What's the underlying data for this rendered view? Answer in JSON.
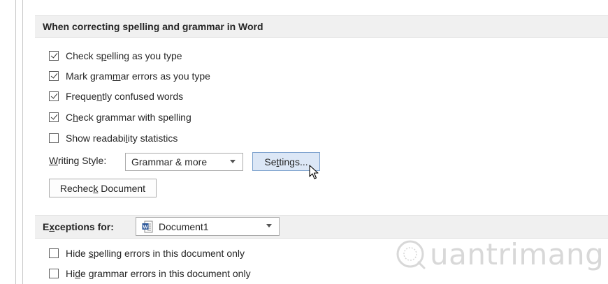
{
  "spelling_section": {
    "header": "When correcting spelling and grammar in Word",
    "options": [
      {
        "pre": "Check s",
        "acc": "p",
        "post": "elling as you type",
        "checked": true
      },
      {
        "pre": "Mark gram",
        "acc": "m",
        "post": "ar errors as you type",
        "checked": true
      },
      {
        "pre": "Freque",
        "acc": "n",
        "post": "tly confused words",
        "checked": true
      },
      {
        "pre": "C",
        "acc": "h",
        "post": "eck grammar with spelling",
        "checked": true
      },
      {
        "pre": "Show readabi",
        "acc": "l",
        "post": "ity statistics",
        "checked": false
      }
    ],
    "writing_style": {
      "pre": "",
      "acc": "W",
      "post": "riting Style:"
    },
    "writing_style_value": "Grammar & more",
    "settings_button": {
      "pre": "Se",
      "acc": "t",
      "post": "tings..."
    },
    "recheck_button": {
      "pre": "Rechec",
      "acc": "k",
      "post": " Document"
    }
  },
  "exceptions_section": {
    "label": {
      "pre": "E",
      "acc": "x",
      "post": "ceptions for:"
    },
    "document_value": "Document1",
    "document_icon": "word-document-icon",
    "options": [
      {
        "pre": "Hide ",
        "acc": "s",
        "post": "pelling errors in this document only",
        "checked": false
      },
      {
        "pre": "Hi",
        "acc": "d",
        "post": "e grammar errors in this document only",
        "checked": false
      }
    ]
  },
  "watermark": {
    "text": "uantrimang",
    "icon": "q-logo-icon"
  }
}
